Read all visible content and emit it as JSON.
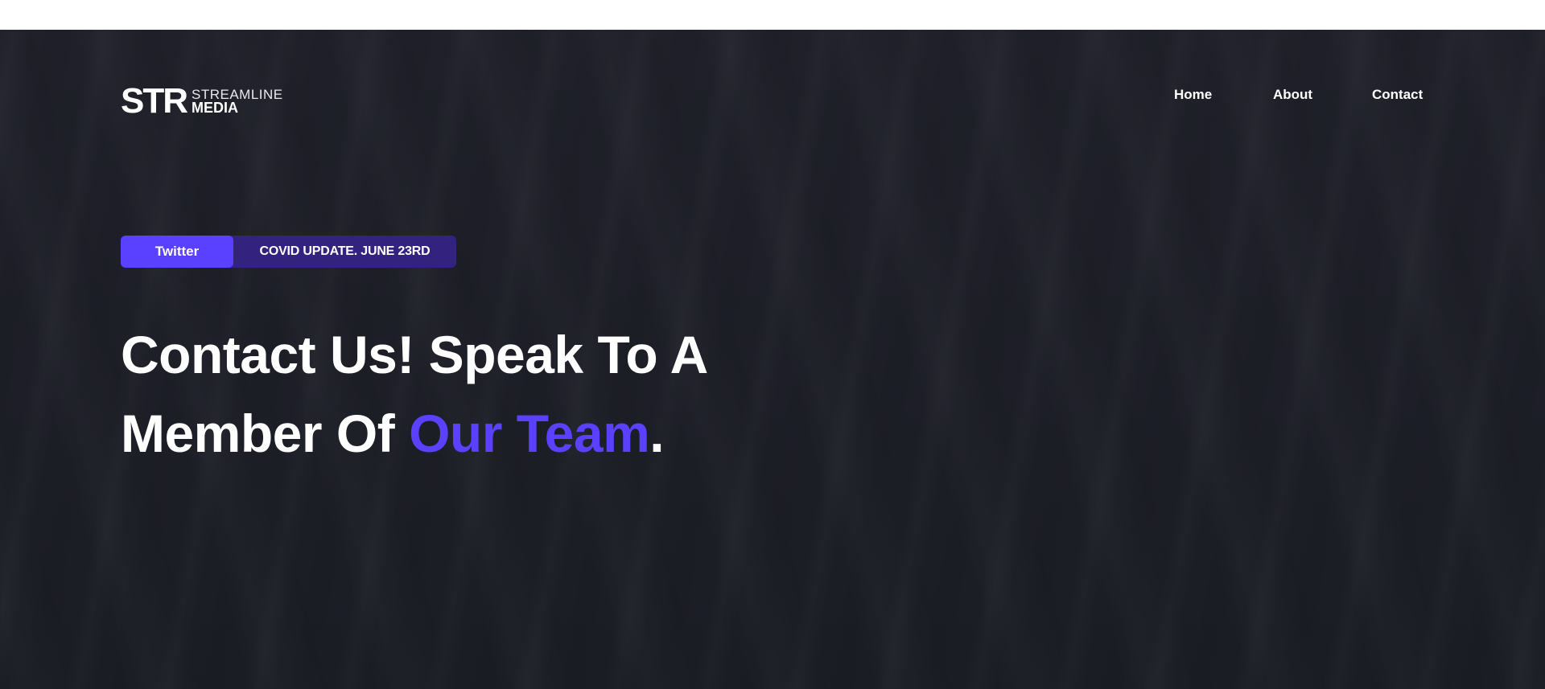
{
  "logo": {
    "mark": "STR",
    "line1": "STREAMLINE",
    "line2": "MEDIA"
  },
  "nav": {
    "items": [
      {
        "label": "Home"
      },
      {
        "label": "About"
      },
      {
        "label": "Contact"
      }
    ]
  },
  "badge": {
    "tag": "Twitter",
    "text": "COVID UPDATE.  JUNE 23RD"
  },
  "headline": {
    "line1": "Contact Us! Speak To A",
    "line2_start": "Member Of ",
    "highlight": "Our Team",
    "end": "."
  },
  "colors": {
    "accent": "#5a40ff",
    "badge_bg": "#33237f",
    "background": "#1c1e26"
  }
}
